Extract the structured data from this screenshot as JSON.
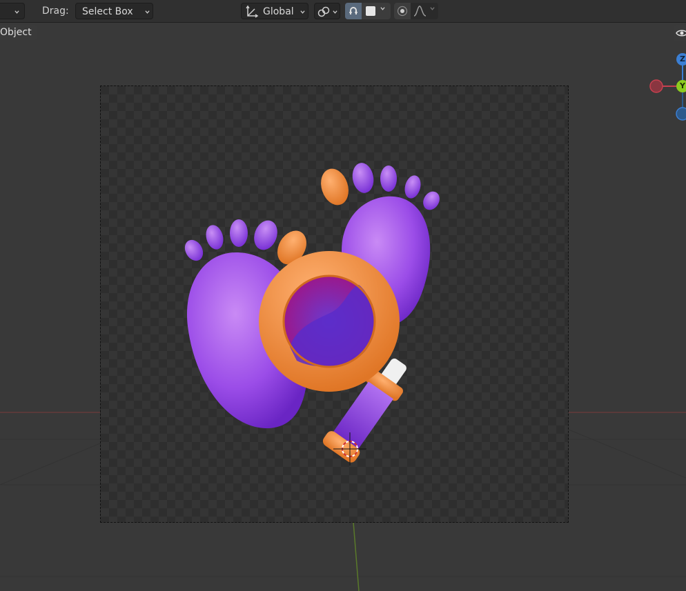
{
  "toolbar": {
    "drag_label": "Drag:",
    "drag_value": "Select Box",
    "orientation_value": "Global"
  },
  "viewport": {
    "mode_tab": "Object",
    "gizmo": {
      "z_label": "Z",
      "y_label": "Y"
    }
  },
  "colors": {
    "purple": "#9b4de8",
    "orange": "#f08a3c",
    "magenta": "#a3127f",
    "x_axis": "#c8404f",
    "y_axis": "#8ccc1e",
    "z_axis": "#3b7fd4"
  },
  "icons": [
    "chevron-down-icon",
    "orientation-icon",
    "link-icon",
    "snap-icon",
    "proportional-icon",
    "falloff-icon",
    "eye-icon",
    "3d-cursor-icon"
  ]
}
